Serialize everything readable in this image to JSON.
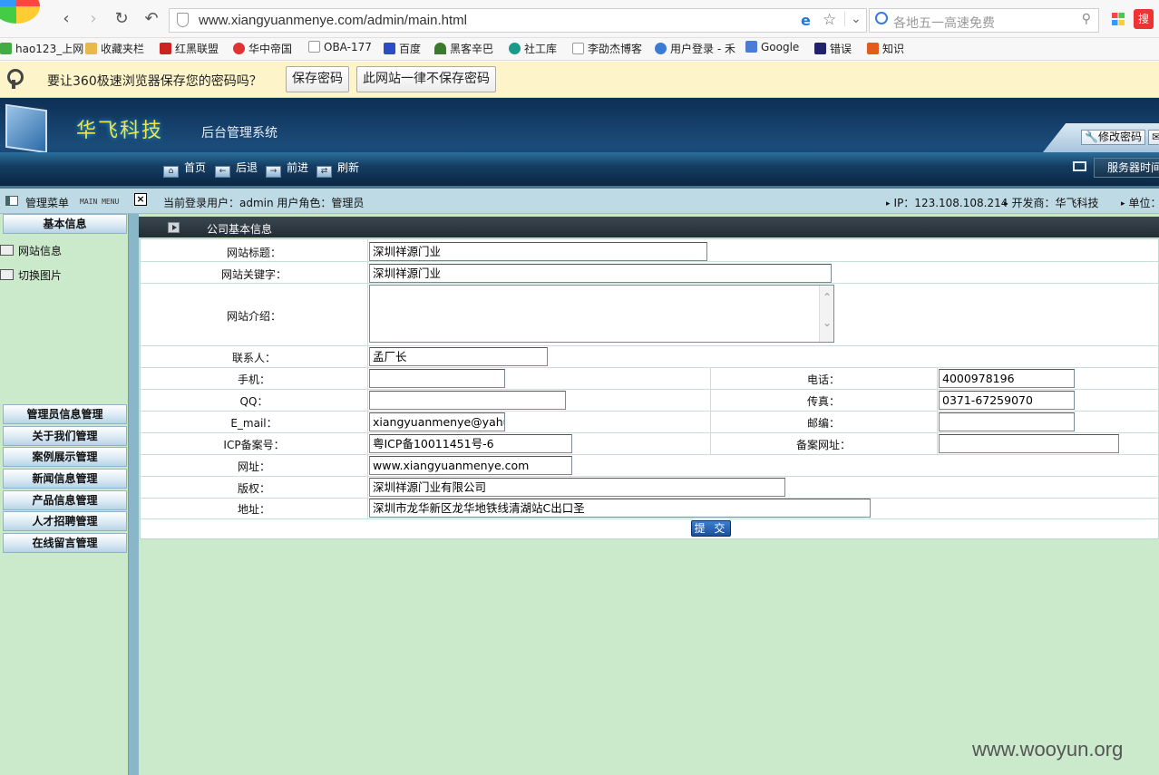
{
  "browser": {
    "url": "www.xiangyuanmenye.com/admin/main.html",
    "search_placeholder": "各地五一高速免费",
    "bookmarks": [
      "hao123_上网",
      "收藏夹栏",
      "红黑联盟",
      "华中帝国",
      "OBA-177",
      "百度",
      "黑客辛巴",
      "社工库",
      "李劭杰博客",
      "用户登录 - 禾",
      "Google",
      "错误",
      "知识"
    ],
    "password_prompt": "要让360极速浏览器保存您的密码吗？",
    "save_password": "保存密码",
    "never_save": "此网站一律不保存密码"
  },
  "header": {
    "brand": "华飞科技",
    "subtitle": "后台管理系统",
    "change_password": "修改密码",
    "nav": [
      "首页",
      "后退",
      "前进",
      "刷新"
    ],
    "server_time": "服务器时间"
  },
  "status": {
    "menu_title": "管理菜单",
    "menu_en": "MAIN MENU",
    "current_user": "当前登录用户：admin  用户角色：管理员",
    "ip": "IP：123.108.108.214",
    "developer": "开发商：华飞科技",
    "unit": "单位："
  },
  "sidebar": {
    "basic": "基本信息",
    "items": [
      "网站信息",
      "切换图片"
    ],
    "sections": [
      "管理员信息管理",
      "关于我们管理",
      "案例展示管理",
      "新闻信息管理",
      "产品信息管理",
      "人才招聘管理",
      "在线留言管理"
    ]
  },
  "form": {
    "title": "公司基本信息",
    "labels": {
      "site_title": "网站标题：",
      "keywords": "网站关键字：",
      "intro": "网站介绍：",
      "contact": "联系人：",
      "mobile": "手机：",
      "phone": "电话：",
      "qq": "QQ：",
      "fax": "传真：",
      "email": "E_mail：",
      "postcode": "邮编：",
      "icp": "ICP备案号：",
      "icp_url": "备案网址：",
      "website": "网址：",
      "copyright": "版权：",
      "address": "地址："
    },
    "values": {
      "site_title": "深圳祥源门业",
      "keywords": "深圳祥源门业",
      "intro": "",
      "contact": "孟厂长",
      "mobile": "",
      "phone": "4000978196",
      "qq": "",
      "fax": "0371-67259070",
      "email": "xiangyuanmenye@yahu.c",
      "postcode": "",
      "icp": "粤ICP备10011451号-6",
      "icp_url": "",
      "website": "www.xiangyuanmenye.com",
      "copyright": "深圳祥源门业有限公司",
      "address": "深圳市龙华新区龙华地铁线清湖站C出口圣"
    },
    "submit": "提 交"
  },
  "watermark": "www.wooyun.org"
}
